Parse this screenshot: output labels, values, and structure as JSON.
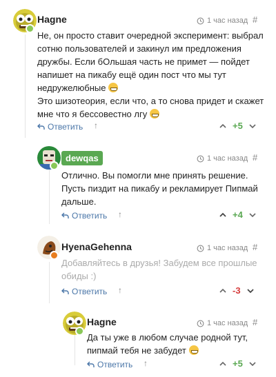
{
  "colors": {
    "link": "#4a76a8",
    "positive": "#5aa852",
    "negative": "#d63c3c",
    "muted": "#888888"
  },
  "comments": [
    {
      "user": "Hagne",
      "time": "1 час назад",
      "hash": "#",
      "lines": [
        "Не, он просто ставит очередной эксперимент: выбрал",
        "сотню пользователей и закинул им предложения",
        "дружбы. Если бОльшая часть не примет — пойдет",
        "напишет на пикабу ещё один пост что мы тут",
        "недружелюбные",
        "Это шизотеория, если что, а то снова придет и скажет",
        "мне что я бессовестно лгу"
      ],
      "reply": "Ответить",
      "score": "+5"
    },
    {
      "user": "dewqas",
      "time": "1 час назад",
      "hash": "#",
      "lines": [
        "Отлично. Вы помогли мне принять решение.",
        "Пусть пиздит на пикабу и рекламирует Пипмай",
        "дальше."
      ],
      "reply": "Ответить",
      "score": "+4"
    },
    {
      "user": "HyenaGehenna",
      "time": "1 час назад",
      "hash": "#",
      "lines": [
        "Добавляйтесь в друзья! Забудем все прошлые",
        "обиды :)"
      ],
      "reply": "Ответить",
      "score": "-3"
    },
    {
      "user": "Hagne",
      "time": "1 час назад",
      "hash": "#",
      "lines": [
        "Да ты уже в любом случае родной тут,",
        "пипмай тебя не забудет"
      ],
      "reply": "Ответить",
      "score": "+5"
    }
  ],
  "icons": {
    "time": "clock-history-icon",
    "reply": "reply-arrow-icon",
    "up": "chevron-up-icon",
    "down": "chevron-down-icon",
    "emoji": "grinning-emoji-icon"
  }
}
